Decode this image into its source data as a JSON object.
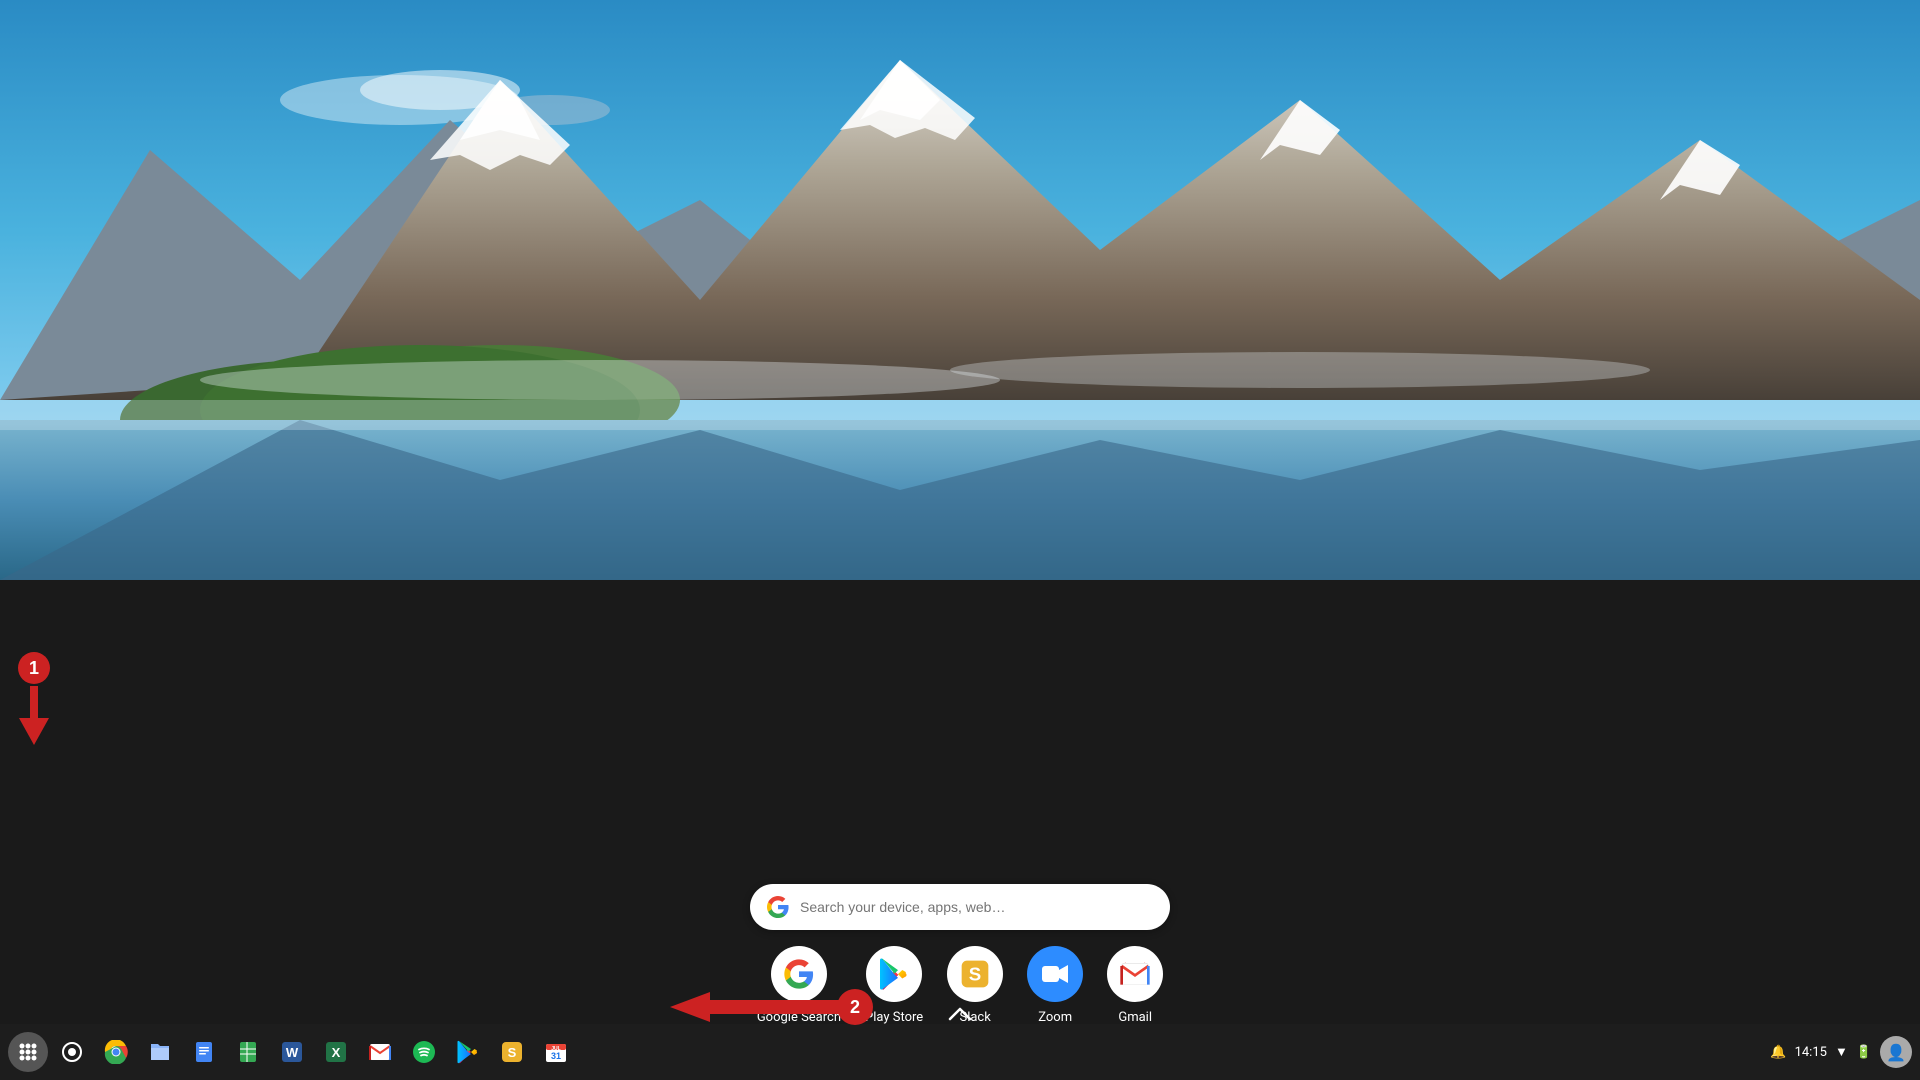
{
  "wallpaper": {
    "alt": "Mountain lake landscape with snow-capped peaks"
  },
  "searchBar": {
    "placeholder": "Search your device, apps, web…",
    "gLogo": "G"
  },
  "appLauncher": {
    "apps": [
      {
        "id": "google-search",
        "label": "Google Search",
        "icon": "G",
        "type": "google"
      },
      {
        "id": "play-store",
        "label": "Play Store",
        "icon": "play",
        "type": "play"
      },
      {
        "id": "slack",
        "label": "Slack",
        "icon": "S",
        "type": "slack"
      },
      {
        "id": "zoom",
        "label": "Zoom",
        "icon": "zoom",
        "type": "zoom"
      },
      {
        "id": "gmail",
        "label": "Gmail",
        "icon": "gmail",
        "type": "gmail"
      }
    ]
  },
  "shelf": {
    "apps": [
      {
        "id": "launcher",
        "label": "Launcher",
        "type": "launcher"
      },
      {
        "id": "chromebook-settings",
        "label": "Settings",
        "type": "settings"
      },
      {
        "id": "chrome",
        "label": "Google Chrome",
        "type": "chrome"
      },
      {
        "id": "files",
        "label": "Files",
        "type": "files"
      },
      {
        "id": "docs",
        "label": "Google Docs",
        "type": "docs"
      },
      {
        "id": "sheets",
        "label": "Google Sheets",
        "type": "sheets"
      },
      {
        "id": "word",
        "label": "Microsoft Word",
        "type": "word"
      },
      {
        "id": "excel",
        "label": "Microsoft Excel",
        "type": "excel"
      },
      {
        "id": "gmail-shelf",
        "label": "Gmail",
        "type": "gmail"
      },
      {
        "id": "spotify",
        "label": "Spotify",
        "type": "spotify"
      },
      {
        "id": "play-store-shelf",
        "label": "Play Store",
        "type": "play"
      },
      {
        "id": "slack-shelf",
        "label": "Slack",
        "type": "slack"
      },
      {
        "id": "calendar",
        "label": "Google Calendar",
        "type": "calendar"
      }
    ]
  },
  "systemTray": {
    "time": "14:15",
    "notificationIcon": "🔔",
    "networkIcon": "▼",
    "batteryIcon": "🔋"
  },
  "annotations": {
    "arrow1": {
      "number": "1",
      "direction": "down"
    },
    "arrow2": {
      "number": "2",
      "direction": "left"
    }
  },
  "upArrow": "∧"
}
